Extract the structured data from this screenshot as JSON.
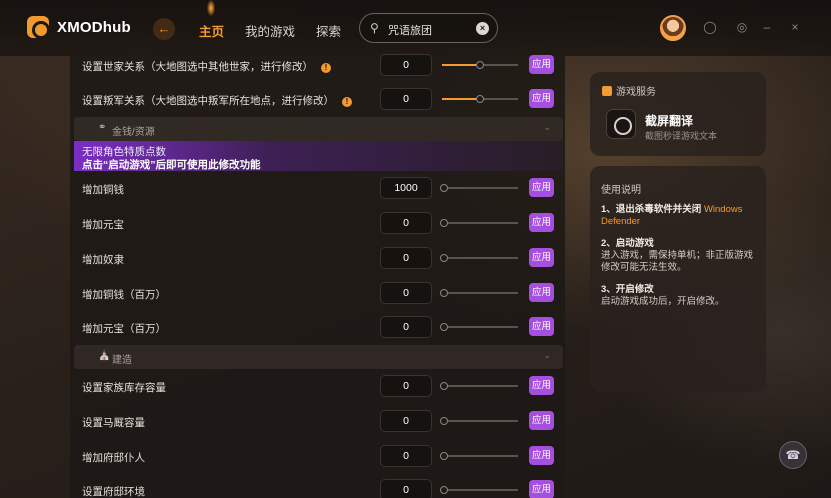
{
  "app": {
    "name": "XMODhub"
  },
  "nav": {
    "back_icon": "arrow-left-icon",
    "items": [
      "主页",
      "我的游戏",
      "探索"
    ],
    "active": 0
  },
  "search": {
    "value": "咒语旅团",
    "clear_icon": "close-icon"
  },
  "window_controls": [
    "notification-icon",
    "settings-icon",
    "minimize-icon",
    "close-icon"
  ],
  "sections": {
    "money": "金钱/资源",
    "build": "建造"
  },
  "banner": {
    "line1": "无限角色特质点数",
    "line2": "点击“启动游戏”后即可使用此修改功能"
  },
  "apply_label": "应用",
  "rows_top": [
    {
      "label": "设置世家关系（大地图选中其他世家，进行修改）",
      "value": "0",
      "slider_fraction": 0.5,
      "warn": "!"
    },
    {
      "label": "设置叛军关系（大地图选中叛军所在地点，进行修改）",
      "value": "0",
      "slider_fraction": 0.5,
      "warn": "!"
    }
  ],
  "rows_money": [
    {
      "label": "增加铜钱",
      "value": "1000",
      "slider_fraction": 0.0
    },
    {
      "label": "增加元宝",
      "value": "0",
      "slider_fraction": 0.0
    },
    {
      "label": "增加奴隶",
      "value": "0",
      "slider_fraction": 0.0
    },
    {
      "label": "增加铜钱（百万）",
      "value": "0",
      "slider_fraction": 0.0
    },
    {
      "label": "增加元宝（百万）",
      "value": "0",
      "slider_fraction": 0.0
    }
  ],
  "rows_build": [
    {
      "label": "设置家族库存容量",
      "value": "0",
      "slider_fraction": 0.0
    },
    {
      "label": "设置马厩容量",
      "value": "0",
      "slider_fraction": 0.0
    },
    {
      "label": "增加府邸仆人",
      "value": "0",
      "slider_fraction": 0.0
    },
    {
      "label": "设置府邸环境",
      "value": "0",
      "slider_fraction": 0.0
    }
  ],
  "game_service": {
    "title": "游戏服务",
    "tool_title": "截屏翻译",
    "tool_desc": "截图秒译游戏文本"
  },
  "instructions": {
    "title": "使用说明",
    "steps": [
      {
        "head": "1、退出杀毒软件并关闭",
        "highlight": "Windows Defender",
        "body": ""
      },
      {
        "head": "2、启动游戏",
        "highlight": "",
        "body": "进入游戏，需保持单机；非正版游戏修改可能无法生效。"
      },
      {
        "head": "3、开启修改",
        "highlight": "",
        "body": "启动游戏成功后，开启修改。"
      }
    ]
  },
  "colors": {
    "accent": "#f39a32",
    "apply": "#a54fe0"
  }
}
